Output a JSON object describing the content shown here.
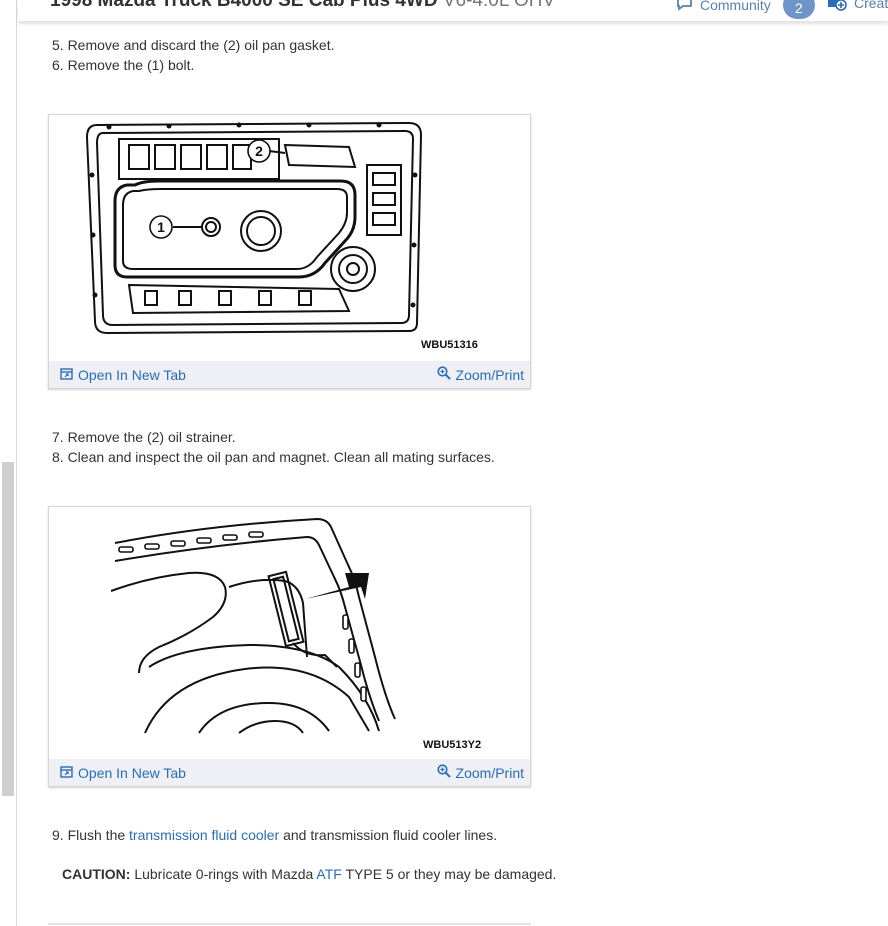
{
  "header": {
    "title_bold": "1998 Mazda Truck B4000 SE Cab Plus 4WD",
    "title_engine": "V6-4.0L OHV",
    "community_label": "Community",
    "community_count": "2",
    "create_label": "Creat"
  },
  "steps": {
    "s5": "5. Remove and discard the (2) oil pan gasket.",
    "s6": "6. Remove the (1) bolt.",
    "s7": "7. Remove the (2) oil strainer.",
    "s8": "8. Clean and inspect the oil pan and magnet. Clean all mating surfaces.",
    "s9_before": "9. Flush the ",
    "s9_link": "transmission fluid cooler",
    "s9_after": " and transmission fluid cooler lines."
  },
  "caution": {
    "label": "CAUTION:",
    "before": " Lubricate 0-rings with Mazda ",
    "link": "ATF",
    "after": " TYPE 5 or they may be damaged."
  },
  "figures": [
    {
      "code": "WBU51316",
      "callout_1": "1",
      "callout_2": "2",
      "open_tab_label": "Open In New Tab",
      "zoom_label": "Zoom/Print"
    },
    {
      "code": "WBU513Y2",
      "open_tab_label": "Open In New Tab",
      "zoom_label": "Zoom/Print"
    }
  ],
  "icons": {
    "community": "chat-bubble-icon",
    "create": "add-document-icon",
    "open_tab": "open-new-tab-icon",
    "zoom": "magnifier-icon"
  },
  "colors": {
    "link": "#2a6db5",
    "toolbar_bg": "#eef0f6",
    "badge": "#6f95c8"
  }
}
